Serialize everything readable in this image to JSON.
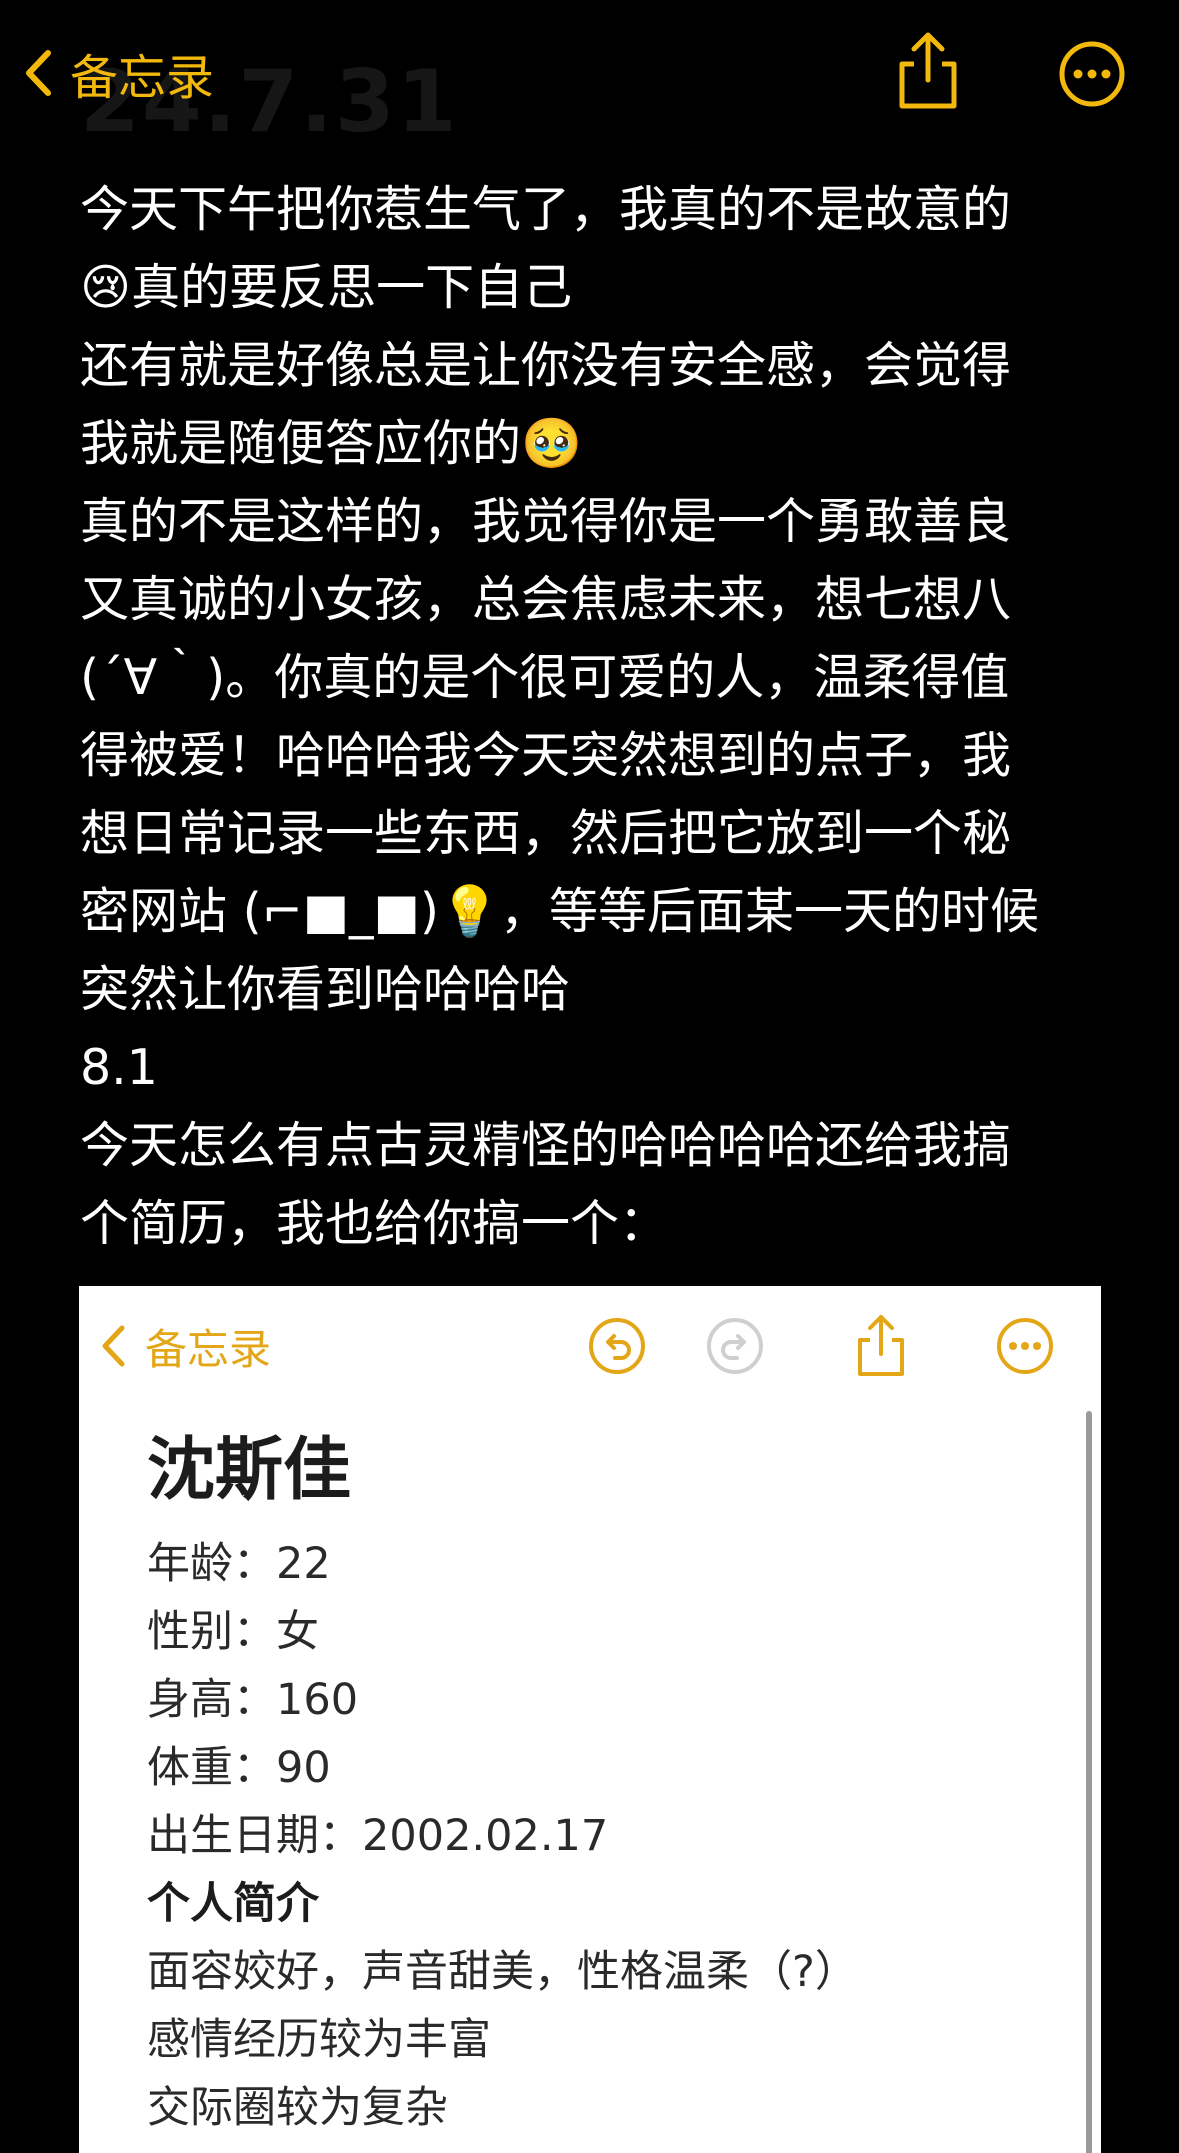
{
  "colors": {
    "accent": "#f2b90c",
    "embedded_accent": "#e3a617",
    "background": "#000000",
    "text": "#ffffff"
  },
  "header": {
    "ghost_date": "24.7.31",
    "back_label": "备忘录",
    "back_icon": "chevron-left-icon",
    "share_icon": "share-icon",
    "more_icon": "more-icon"
  },
  "note": {
    "lines": [
      "今天下午把你惹生气了，我真的不是故意的",
      "😢真的要反思一下自己",
      "还有就是好像总是让你没有安全感，会觉得",
      "我就是随便答应你的🥹",
      "真的不是这样的，我觉得你是一个勇敢善良",
      "又真诚的小女孩，总会焦虑未来，想七想八",
      "(´∀｀)。你真的是个很可爱的人，温柔得值",
      "得被爱！哈哈哈我今天突然想到的点子，我",
      "想日常记录一些东西，然后把它放到一个秘",
      "密网站 (⌐■_■)💡，等等后面某一天的时候",
      "突然让你看到哈哈哈哈",
      "8.1",
      "今天怎么有点古灵精怪的哈哈哈哈还给我搞",
      "个简历，我也给你搞一个："
    ]
  },
  "embedded": {
    "back_label": "备忘录",
    "icons": [
      "chevron-left-icon",
      "undo-icon",
      "redo-icon",
      "share-icon",
      "more-icon"
    ],
    "title": "沈斯佳",
    "fields": [
      "年龄：22",
      "性别：女",
      "身高：160",
      "体重：90",
      "出生日期：2002.02.17"
    ],
    "section_heading": "个人简介",
    "intro_lines": [
      "面容姣好，声音甜美，性格温柔（?）",
      "感情经历较为丰富",
      "交际圈较为复杂"
    ]
  }
}
